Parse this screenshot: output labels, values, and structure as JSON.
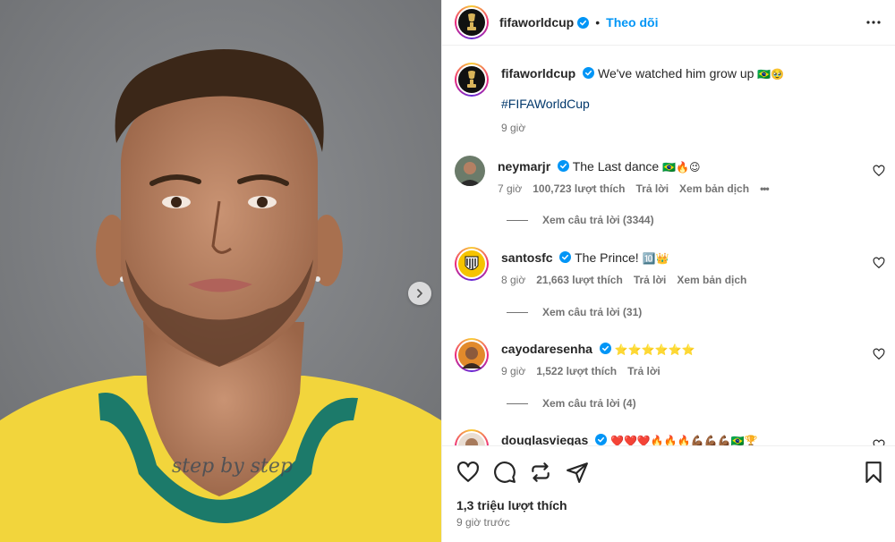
{
  "post": {
    "author": "fifaworldcup",
    "follow_label": "Theo dõi",
    "separator": "•",
    "caption_text": "We've watched him grow up",
    "caption_emoji": "🇧🇷🥹",
    "hashtag": "#FIFAWorldCup",
    "caption_time": "9 giờ",
    "likes": "1,3 triệu lượt thích",
    "time_ago": "9 giờ trước",
    "photo_text": "step by step"
  },
  "comments": [
    {
      "username": "neymarjr",
      "text": "The Last dance",
      "emoji": "🇧🇷🔥😉",
      "time": "7 giờ",
      "likes": "100,723 lượt thích",
      "reply": "Trả lời",
      "translate": "Xem bản dịch",
      "more": "•••",
      "view_replies": "Xem câu trả lời (3344)"
    },
    {
      "username": "santosfc",
      "text": "The Prince!",
      "emoji": "🔟👑",
      "time": "8 giờ",
      "likes": "21,663 lượt thích",
      "reply": "Trả lời",
      "translate": "Xem bản dịch",
      "view_replies": "Xem câu trả lời (31)"
    },
    {
      "username": "cayodaresenha",
      "text": "",
      "emoji": "⭐⭐⭐⭐⭐⭐",
      "time": "9 giờ",
      "likes": "1,522 lượt thích",
      "reply": "Trả lời",
      "view_replies": "Xem câu trả lời (4)"
    },
    {
      "username": "douglasviegas",
      "text": "",
      "emoji": "❤️❤️❤️🔥🔥🔥💪🏾💪🏾💪🏾🇧🇷🏆"
    }
  ],
  "icons": {
    "verified": "verified-badge-icon",
    "more": "more-horizontal-icon",
    "like": "heart-icon",
    "comment": "comment-icon",
    "repost": "repost-icon",
    "share": "paper-plane-icon",
    "save": "bookmark-icon",
    "next": "chevron-right-icon"
  },
  "colors": {
    "accent": "#0095f6",
    "hashtag": "#00376b",
    "verified": "#0095f6",
    "secondary_text": "#737373",
    "jersey_yellow": "#f2d53c",
    "jersey_collar": "#1c7a6a"
  }
}
